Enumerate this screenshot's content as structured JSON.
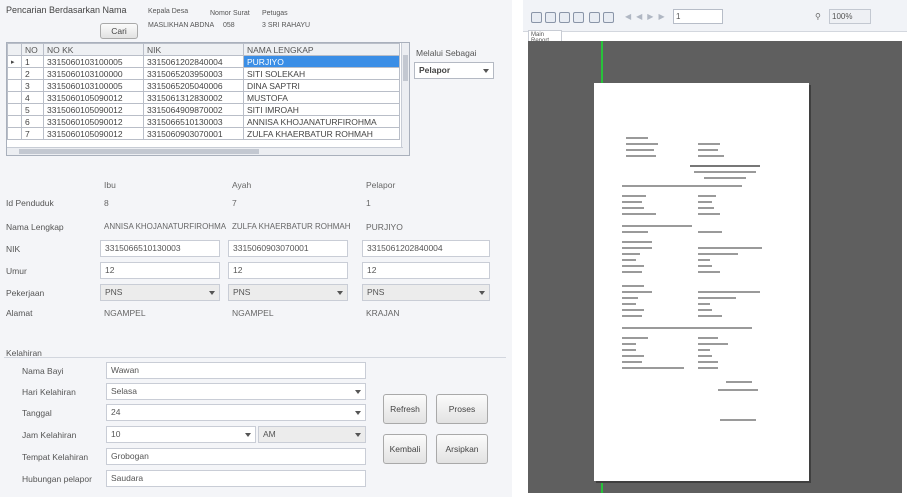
{
  "search": {
    "title": "Pencarian Berdasarkan Nama",
    "cari_button": "Cari",
    "kepala_desa_label": "Kepala Desa",
    "kepala_desa_value": "MASLIKHAN ABDNA",
    "nomor_surat_label": "Nomor Surat",
    "nomor_surat_value": "058",
    "petugas_label": "Petugas",
    "petugas_value": "3   SRI RAHAYU"
  },
  "table": {
    "headers": [
      "NO",
      "NO KK",
      "NIK",
      "NAMA LENGKAP"
    ],
    "rows": [
      [
        "1",
        "3315060103100005",
        "3315061202840004",
        "PURJIYO"
      ],
      [
        "2",
        "3315060103100000",
        "3315065203950003",
        "SITI SOLEKAH"
      ],
      [
        "3",
        "3315060103100005",
        "3315065205040006",
        "DINA SAPTRI"
      ],
      [
        "4",
        "3315060105090012",
        "3315061312830002",
        "MUSTOFA"
      ],
      [
        "5",
        "3315060105090012",
        "3315064909870002",
        "SITI IMROAH"
      ],
      [
        "6",
        "3315060105090012",
        "3315066510130003",
        "ANNISA KHOJANATURFIROHMA"
      ],
      [
        "7",
        "3315060105090012",
        "3315060903070001",
        "ZULFA KHAERBATUR ROHMAH"
      ]
    ]
  },
  "melalui": {
    "label": "Melalui Sebagai",
    "value": "Pelapor"
  },
  "columns": {
    "ibu": "Ibu",
    "ayah": "Ayah",
    "pelapor": "Pelapor"
  },
  "fields": {
    "id_penduduk": {
      "label": "Id Penduduk",
      "ibu": "8",
      "ayah": "7",
      "pelapor": "1"
    },
    "nama_lengkap": {
      "label": "Nama Lengkap",
      "ibu": "ANNISA KHOJANATURFIROHMA",
      "ayah": "ZULFA KHAERBATUR ROHMAH",
      "pelapor": "PURJIYO"
    },
    "nik": {
      "label": "NIK",
      "ibu": "3315066510130003",
      "ayah": "3315060903070001",
      "pelapor": "3315061202840004"
    },
    "umur": {
      "label": "Umur",
      "ibu": "12",
      "ayah": "12",
      "pelapor": "12"
    },
    "pekerjaan": {
      "label": "Pekerjaan",
      "ibu": "PNS",
      "ayah": "PNS",
      "pelapor": "PNS"
    },
    "alamat": {
      "label": "Alamat",
      "ibu": "NGAMPEL",
      "ayah": "NGAMPEL",
      "pelapor": "KRAJAN"
    }
  },
  "kelahiran": {
    "section_title": "Kelahiran",
    "nama_bayi": {
      "label": "Nama Bayi",
      "value": "Wawan"
    },
    "hari": {
      "label": "Hari Kelahiran",
      "value": "Selasa"
    },
    "tanggal": {
      "label": "Tanggal",
      "value": "24"
    },
    "jam": {
      "label": "Jam Kelahiran",
      "value": "10",
      "ampm": "AM"
    },
    "tempat": {
      "label": "Tempat Kelahiran",
      "value": "Grobogan"
    },
    "hubungan": {
      "label": "Hubungan pelapor",
      "value": "Saudara"
    }
  },
  "buttons": {
    "refresh": "Refresh",
    "proses": "Proses",
    "kembali": "Kembali",
    "arsipkan": "Arsipkan"
  },
  "report": {
    "tab_label": "Main Report",
    "page_value": "1",
    "zoom_value": "100%"
  },
  "colors": {
    "selection": "#3a8ee6",
    "report_bg": "#5f5f5f",
    "accent_line": "#27c23a"
  }
}
